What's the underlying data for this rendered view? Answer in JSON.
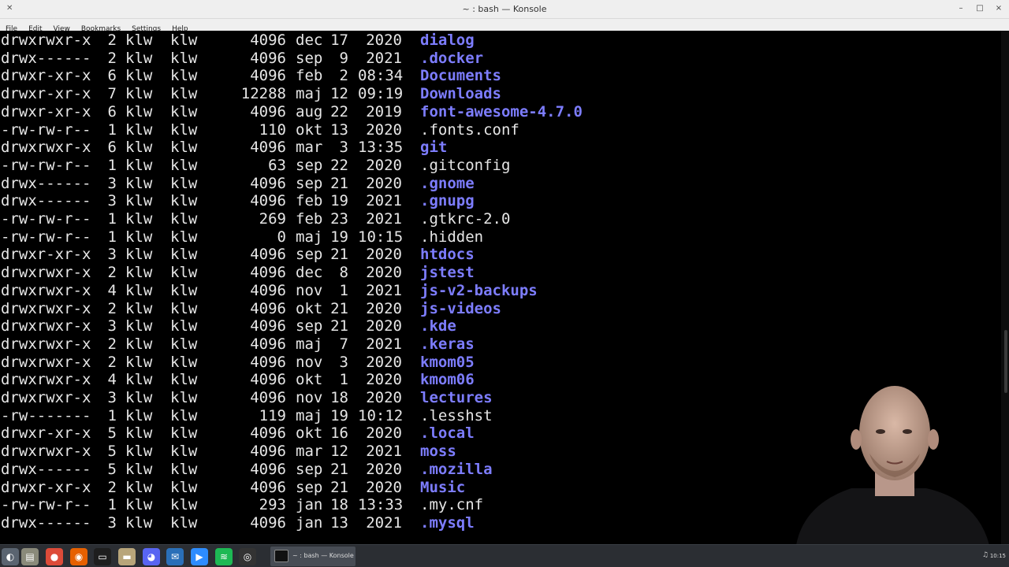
{
  "window": {
    "title": "~ : bash — Konsole",
    "system_icon": "konsole-system-menu-icon",
    "minimize_glyph": "–",
    "maximize_glyph": "□",
    "close_glyph": "×"
  },
  "menu": [
    "File",
    "Edit",
    "View",
    "Bookmarks",
    "Settings",
    "Help"
  ],
  "colors": {
    "directory": "#7d7dff",
    "file": "#e6e6e6",
    "terminal_bg": "#000000",
    "taskbar_bg": "#2b2e33"
  },
  "listing": [
    {
      "perm": "drwxrwxr-x",
      "links": "2",
      "owner": "klw",
      "group": "klw",
      "size": "4096",
      "month": "dec",
      "day": "17",
      "timeyr": "2020",
      "name": "dialog",
      "dir": true
    },
    {
      "perm": "drwx------",
      "links": "2",
      "owner": "klw",
      "group": "klw",
      "size": "4096",
      "month": "sep",
      "day": "9",
      "timeyr": "2021",
      "name": ".docker",
      "dir": true
    },
    {
      "perm": "drwxr-xr-x",
      "links": "6",
      "owner": "klw",
      "group": "klw",
      "size": "4096",
      "month": "feb",
      "day": "2",
      "timeyr": "08:34",
      "name": "Documents",
      "dir": true
    },
    {
      "perm": "drwxr-xr-x",
      "links": "7",
      "owner": "klw",
      "group": "klw",
      "size": "12288",
      "month": "maj",
      "day": "12",
      "timeyr": "09:19",
      "name": "Downloads",
      "dir": true
    },
    {
      "perm": "drwxr-xr-x",
      "links": "6",
      "owner": "klw",
      "group": "klw",
      "size": "4096",
      "month": "aug",
      "day": "22",
      "timeyr": "2019",
      "name": "font-awesome-4.7.0",
      "dir": true
    },
    {
      "perm": "-rw-rw-r--",
      "links": "1",
      "owner": "klw",
      "group": "klw",
      "size": "110",
      "month": "okt",
      "day": "13",
      "timeyr": "2020",
      "name": ".fonts.conf",
      "dir": false
    },
    {
      "perm": "drwxrwxr-x",
      "links": "6",
      "owner": "klw",
      "group": "klw",
      "size": "4096",
      "month": "mar",
      "day": "3",
      "timeyr": "13:35",
      "name": "git",
      "dir": true
    },
    {
      "perm": "-rw-rw-r--",
      "links": "1",
      "owner": "klw",
      "group": "klw",
      "size": "63",
      "month": "sep",
      "day": "22",
      "timeyr": "2020",
      "name": ".gitconfig",
      "dir": false
    },
    {
      "perm": "drwx------",
      "links": "3",
      "owner": "klw",
      "group": "klw",
      "size": "4096",
      "month": "sep",
      "day": "21",
      "timeyr": "2020",
      "name": ".gnome",
      "dir": true
    },
    {
      "perm": "drwx------",
      "links": "3",
      "owner": "klw",
      "group": "klw",
      "size": "4096",
      "month": "feb",
      "day": "19",
      "timeyr": "2021",
      "name": ".gnupg",
      "dir": true
    },
    {
      "perm": "-rw-rw-r--",
      "links": "1",
      "owner": "klw",
      "group": "klw",
      "size": "269",
      "month": "feb",
      "day": "23",
      "timeyr": "2021",
      "name": ".gtkrc-2.0",
      "dir": false
    },
    {
      "perm": "-rw-rw-r--",
      "links": "1",
      "owner": "klw",
      "group": "klw",
      "size": "0",
      "month": "maj",
      "day": "19",
      "timeyr": "10:15",
      "name": ".hidden",
      "dir": false
    },
    {
      "perm": "drwxr-xr-x",
      "links": "3",
      "owner": "klw",
      "group": "klw",
      "size": "4096",
      "month": "sep",
      "day": "21",
      "timeyr": "2020",
      "name": "htdocs",
      "dir": true
    },
    {
      "perm": "drwxrwxr-x",
      "links": "2",
      "owner": "klw",
      "group": "klw",
      "size": "4096",
      "month": "dec",
      "day": "8",
      "timeyr": "2020",
      "name": "jstest",
      "dir": true
    },
    {
      "perm": "drwxrwxr-x",
      "links": "4",
      "owner": "klw",
      "group": "klw",
      "size": "4096",
      "month": "nov",
      "day": "1",
      "timeyr": "2021",
      "name": "js-v2-backups",
      "dir": true
    },
    {
      "perm": "drwxrwxr-x",
      "links": "2",
      "owner": "klw",
      "group": "klw",
      "size": "4096",
      "month": "okt",
      "day": "21",
      "timeyr": "2020",
      "name": "js-videos",
      "dir": true
    },
    {
      "perm": "drwxrwxr-x",
      "links": "3",
      "owner": "klw",
      "group": "klw",
      "size": "4096",
      "month": "sep",
      "day": "21",
      "timeyr": "2020",
      "name": ".kde",
      "dir": true
    },
    {
      "perm": "drwxrwxr-x",
      "links": "2",
      "owner": "klw",
      "group": "klw",
      "size": "4096",
      "month": "maj",
      "day": "7",
      "timeyr": "2021",
      "name": ".keras",
      "dir": true
    },
    {
      "perm": "drwxrwxr-x",
      "links": "2",
      "owner": "klw",
      "group": "klw",
      "size": "4096",
      "month": "nov",
      "day": "3",
      "timeyr": "2020",
      "name": "kmom05",
      "dir": true
    },
    {
      "perm": "drwxrwxr-x",
      "links": "4",
      "owner": "klw",
      "group": "klw",
      "size": "4096",
      "month": "okt",
      "day": "1",
      "timeyr": "2020",
      "name": "kmom06",
      "dir": true
    },
    {
      "perm": "drwxrwxr-x",
      "links": "3",
      "owner": "klw",
      "group": "klw",
      "size": "4096",
      "month": "nov",
      "day": "18",
      "timeyr": "2020",
      "name": "lectures",
      "dir": true
    },
    {
      "perm": "-rw-------",
      "links": "1",
      "owner": "klw",
      "group": "klw",
      "size": "119",
      "month": "maj",
      "day": "19",
      "timeyr": "10:12",
      "name": ".lesshst",
      "dir": false
    },
    {
      "perm": "drwxr-xr-x",
      "links": "5",
      "owner": "klw",
      "group": "klw",
      "size": "4096",
      "month": "okt",
      "day": "16",
      "timeyr": "2020",
      "name": ".local",
      "dir": true
    },
    {
      "perm": "drwxrwxr-x",
      "links": "5",
      "owner": "klw",
      "group": "klw",
      "size": "4096",
      "month": "mar",
      "day": "12",
      "timeyr": "2021",
      "name": "moss",
      "dir": true
    },
    {
      "perm": "drwx------",
      "links": "5",
      "owner": "klw",
      "group": "klw",
      "size": "4096",
      "month": "sep",
      "day": "21",
      "timeyr": "2020",
      "name": ".mozilla",
      "dir": true
    },
    {
      "perm": "drwxr-xr-x",
      "links": "2",
      "owner": "klw",
      "group": "klw",
      "size": "4096",
      "month": "sep",
      "day": "21",
      "timeyr": "2020",
      "name": "Music",
      "dir": true
    },
    {
      "perm": "-rw-rw-r--",
      "links": "1",
      "owner": "klw",
      "group": "klw",
      "size": "293",
      "month": "jan",
      "day": "18",
      "timeyr": "13:33",
      "name": ".my.cnf",
      "dir": false
    },
    {
      "perm": "drwx------",
      "links": "3",
      "owner": "klw",
      "group": "klw",
      "size": "4096",
      "month": "jan",
      "day": "13",
      "timeyr": "2021",
      "name": ".mysql",
      "dir": true
    }
  ],
  "taskbar": {
    "launchers": [
      {
        "icon": "application-menu-icon",
        "color": "#5a6470",
        "glyph": "◐"
      },
      {
        "icon": "file-manager-icon",
        "color": "#8a8a7a",
        "glyph": "▤"
      },
      {
        "icon": "chrome-icon",
        "color": "#dd4b39",
        "glyph": "●"
      },
      {
        "icon": "firefox-icon",
        "color": "#e66000",
        "glyph": "◉"
      },
      {
        "icon": "terminal-icon",
        "color": "#1e1e1e",
        "glyph": "▭"
      },
      {
        "icon": "folder-icon",
        "color": "#b8a57a",
        "glyph": "▬"
      },
      {
        "icon": "discord-icon",
        "color": "#5865f2",
        "glyph": "◕"
      },
      {
        "icon": "thunderbird-icon",
        "color": "#2a6fb8",
        "glyph": "✉"
      },
      {
        "icon": "zoom-icon",
        "color": "#2d8cff",
        "glyph": "▶"
      },
      {
        "icon": "spotify-icon",
        "color": "#1db954",
        "glyph": "≋"
      },
      {
        "icon": "obs-icon",
        "color": "#333333",
        "glyph": "◎"
      }
    ],
    "task_label": "~ : bash — Konsole",
    "clock": "10:15",
    "volume_glyph": "♫"
  }
}
